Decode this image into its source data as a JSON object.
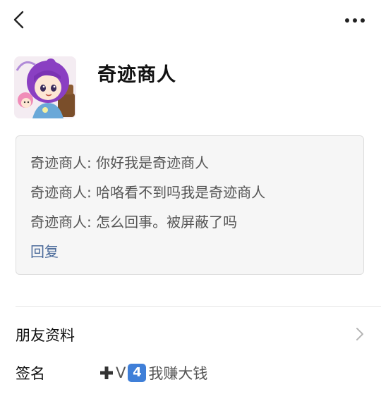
{
  "header": {
    "back_icon": "chevron-left-icon",
    "more_icon": "more-dots-icon"
  },
  "profile": {
    "name": "奇迹商人",
    "avatar": "cartoon-girl-avatar"
  },
  "messages": [
    "奇迹商人: 你好我是奇迹商人",
    "奇迹商人: 哈咯看不到吗我是奇迹商人",
    "奇迹商人: 怎么回事。被屏蔽了吗"
  ],
  "reply_label": "回复",
  "friend_info": {
    "label": "朋友资料",
    "icon": "chevron-right-icon"
  },
  "signature": {
    "label": "签名",
    "plus": "➕",
    "prefix": "V",
    "keycap": "4",
    "text": "我赚大钱"
  },
  "colors": {
    "link": "#4a6a9a",
    "keycap": "#3f7fd8"
  }
}
